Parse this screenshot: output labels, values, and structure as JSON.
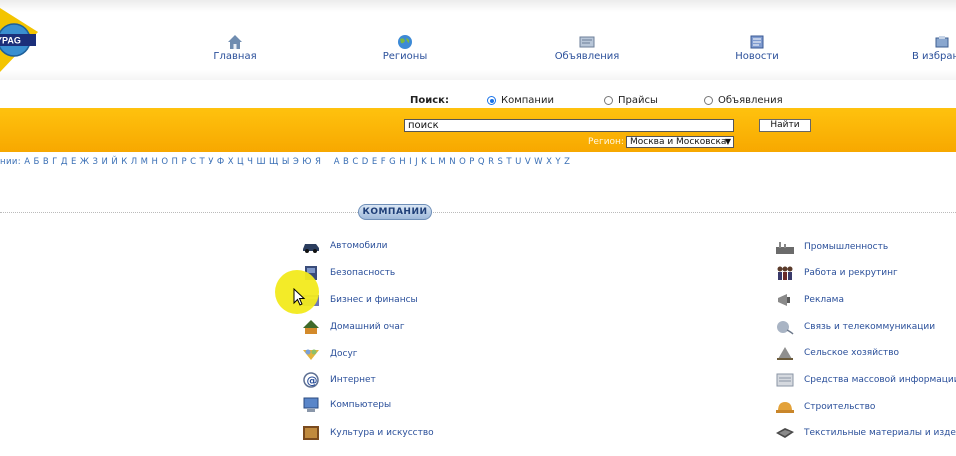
{
  "logo": {
    "text": "YPAG"
  },
  "nav": [
    {
      "label": "Главная",
      "icon": "home-icon"
    },
    {
      "label": "Регионы",
      "icon": "globe-icon"
    },
    {
      "label": "Объявления",
      "icon": "ads-icon"
    },
    {
      "label": "Новости",
      "icon": "news-icon"
    },
    {
      "label": "В избранное",
      "icon": "favorites-icon"
    }
  ],
  "search": {
    "label": "Поиск:",
    "options": [
      "Компании",
      "Прайсы",
      "Объявления"
    ],
    "selected": "Компании",
    "input_value": "поиск",
    "button_label": "Найти",
    "region_label": "Регион:",
    "region_value": "Москва и Московска"
  },
  "alphabet": {
    "lead": "нии:",
    "cyrillic": "А Б В Г Д Е Ж З И Й К Л М Н О П Р С Т У Ф Х Ц Ч Ш Щ Ы Э Ю Я",
    "latin": "A B C D E F G H I J K L M N O P Q R S T U V W X Y Z"
  },
  "section": {
    "title": "КОМПАНИИ"
  },
  "categories_left": [
    {
      "label": "Автомобили",
      "icon": "car-icon"
    },
    {
      "label": "Безопасность",
      "icon": "security-icon"
    },
    {
      "label": "Бизнес и финансы",
      "icon": "finance-icon"
    },
    {
      "label": "Домашний очаг",
      "icon": "home-hearth-icon"
    },
    {
      "label": "Досуг",
      "icon": "leisure-icon"
    },
    {
      "label": "Интернет",
      "icon": "at-sign-icon"
    },
    {
      "label": "Компьютеры",
      "icon": "computer-icon"
    },
    {
      "label": "Культура и искусство",
      "icon": "culture-icon"
    }
  ],
  "categories_right": [
    {
      "label": "Промышленность",
      "icon": "industry-icon"
    },
    {
      "label": "Работа и рекрутинг",
      "icon": "people-icon"
    },
    {
      "label": "Реклама",
      "icon": "megaphone-icon"
    },
    {
      "label": "Связь и телекоммуникации",
      "icon": "phone-icon"
    },
    {
      "label": "Сельское хозяйство",
      "icon": "agriculture-icon"
    },
    {
      "label": "Средства массовой информации",
      "icon": "media-icon"
    },
    {
      "label": "Строительство",
      "icon": "helmet-icon"
    },
    {
      "label": "Текстильные материалы и издели",
      "icon": "textile-icon"
    }
  ],
  "colors": {
    "band": "#f7a800",
    "link": "#2a4f9a",
    "radio": "#1a73e8"
  }
}
